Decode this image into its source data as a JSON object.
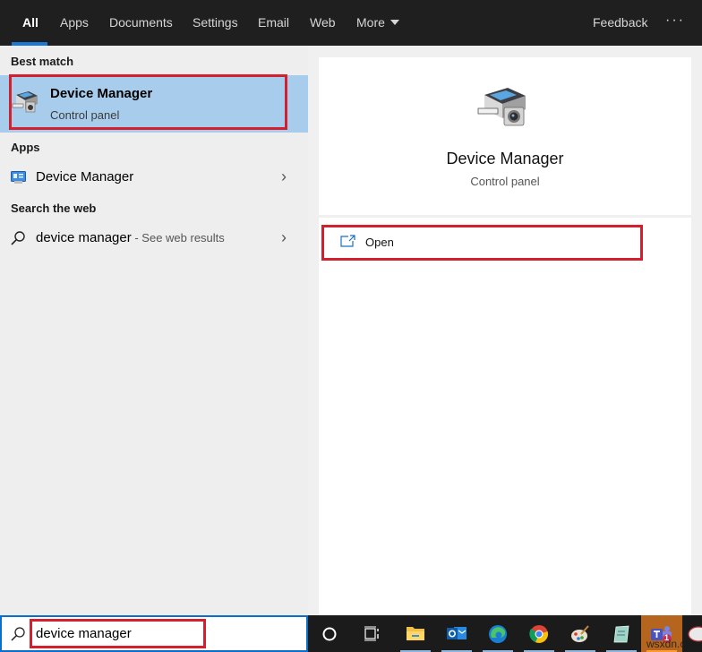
{
  "nav": {
    "tabs": [
      {
        "label": "All",
        "active": true
      },
      {
        "label": "Apps"
      },
      {
        "label": "Documents"
      },
      {
        "label": "Settings"
      },
      {
        "label": "Email"
      },
      {
        "label": "Web"
      },
      {
        "label": "More"
      }
    ],
    "feedback": "Feedback",
    "more_options": "···"
  },
  "results": {
    "best_match_label": "Best match",
    "best_match": {
      "title": "Device Manager",
      "subtitle": "Control panel",
      "icon": "device-manager-icon"
    },
    "apps_label": "Apps",
    "apps": [
      {
        "title": "Device Manager",
        "icon": "control-panel-app-icon"
      }
    ],
    "web_label": "Search the web",
    "web": [
      {
        "query": "device manager",
        "suffix": " - See web results",
        "icon": "search-icon"
      }
    ]
  },
  "detail": {
    "title": "Device Manager",
    "subtitle": "Control panel",
    "actions": [
      {
        "label": "Open",
        "icon": "open-window-icon"
      }
    ]
  },
  "taskbar": {
    "search_value": "device manager",
    "apps": [
      "cortana",
      "task-view",
      "file-explorer",
      "outlook",
      "edge",
      "chrome",
      "paint",
      "notepad",
      "teams",
      "other"
    ],
    "teams_badge": "1"
  },
  "watermark": "wsxdn.com",
  "colors": {
    "accent": "#1a78d4",
    "highlight": "#a8cdec",
    "annotation_red": "#d4202e"
  }
}
